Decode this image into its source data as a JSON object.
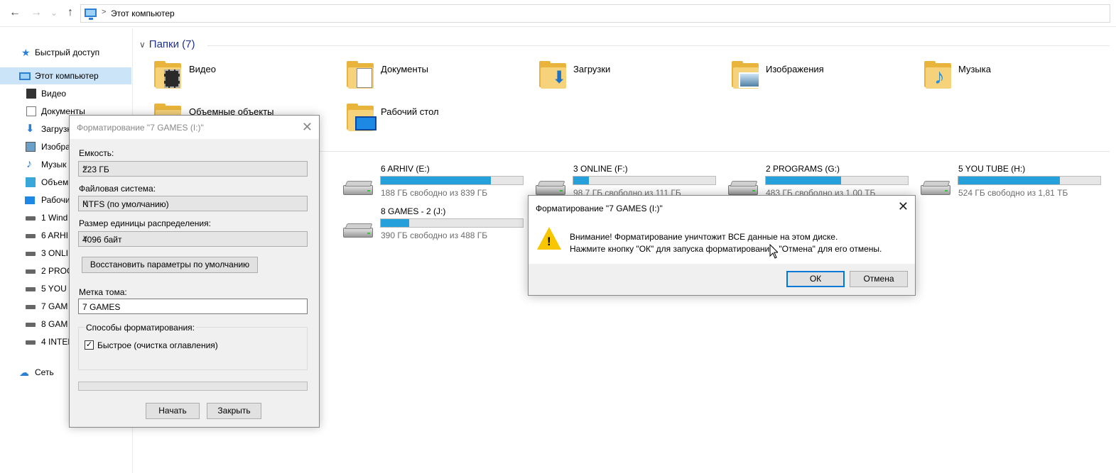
{
  "toolbar": {
    "back": "←",
    "forward": "→",
    "down": "⌄",
    "up": "↑",
    "breadcrumb_sep": ">",
    "breadcrumb": "Этот компьютер"
  },
  "sidebar": {
    "items": [
      {
        "label": "Быстрый доступ",
        "icon": "star-icon"
      },
      {
        "label": "Этот компьютер",
        "icon": "computer-icon"
      },
      {
        "label": "Видео",
        "icon": "video-folder-icon"
      },
      {
        "label": "Документы",
        "icon": "documents-folder-icon"
      },
      {
        "label": "Загрузк",
        "icon": "downloads-folder-icon"
      },
      {
        "label": "Изобра",
        "icon": "pictures-folder-icon"
      },
      {
        "label": "Музык",
        "icon": "music-folder-icon"
      },
      {
        "label": "Объем",
        "icon": "3d-objects-icon"
      },
      {
        "label": "Рабочи",
        "icon": "desktop-icon"
      },
      {
        "label": "1 Wind",
        "icon": "windows-drive-icon"
      },
      {
        "label": "6 ARHI",
        "icon": "drive-icon"
      },
      {
        "label": "3 ONLI",
        "icon": "drive-icon"
      },
      {
        "label": "2 PROG",
        "icon": "drive-icon"
      },
      {
        "label": "5 YOU T",
        "icon": "drive-icon"
      },
      {
        "label": "7 GAM",
        "icon": "drive-icon"
      },
      {
        "label": "8 GAM",
        "icon": "drive-icon"
      },
      {
        "label": "4 INTER",
        "icon": "drive-icon"
      },
      {
        "label": "Сеть",
        "icon": "network-icon"
      }
    ]
  },
  "folders": {
    "header": "Папки (7)",
    "items": [
      {
        "label": "Видео",
        "icon": "video-folder-icon"
      },
      {
        "label": "Документы",
        "icon": "documents-folder-icon"
      },
      {
        "label": "Загрузки",
        "icon": "downloads-folder-icon"
      },
      {
        "label": "Изображения",
        "icon": "pictures-folder-icon"
      },
      {
        "label": "Музыка",
        "icon": "music-folder-icon"
      },
      {
        "label": "Объемные объекты",
        "icon": "3d-objects-folder-icon"
      },
      {
        "label": "Рабочий стол",
        "icon": "desktop-folder-icon"
      }
    ]
  },
  "drives": [
    {
      "name": "6 ARHIV (E:)",
      "free": "188 ГБ свободно из 839 ГБ",
      "used_fraction": 0.776
    },
    {
      "name": "3 ONLINE (F:)",
      "free": "98,7 ГБ свободно из 111 ГБ",
      "used_fraction": 0.111
    },
    {
      "name": "2 PROGRAMS (G:)",
      "free": "483 ГБ свободно из 1,00 ТБ",
      "used_fraction": 0.528
    },
    {
      "name": "5 YOU TUBE (H:)",
      "free": "524 ГБ свободно из 1,81 ТБ",
      "used_fraction": 0.717
    },
    {
      "name": "8 GAMES - 2 (J:)",
      "free": "390 ГБ свободно из 488 ГБ",
      "used_fraction": 0.201
    }
  ],
  "format_dialog": {
    "title": "Форматирование \"7 GAMES (I:)\"",
    "close": "✕",
    "capacity_label": "Емкость:",
    "capacity_value": "223 ГБ",
    "fs_label": "Файловая система:",
    "fs_value": "NTFS (по умолчанию)",
    "alloc_label": "Размер единицы распределения:",
    "alloc_value": "4096 байт",
    "restore_button": "Восстановить параметры по умолчанию",
    "volume_label": "Метка тома:",
    "volume_value": "7 GAMES",
    "options_label": "Способы форматирования:",
    "quick_label": "Быстрое (очистка оглавления)",
    "quick_checked": "✓",
    "progress": 0,
    "start_button": "Начать",
    "close_button": "Закрыть"
  },
  "confirm_dialog": {
    "title": "Форматирование \"7 GAMES (I:)\"",
    "close": "✕",
    "warning_mark": "!",
    "line1": "Внимание! Форматирование уничтожит ВСЕ данные на этом диске.",
    "line2": "Нажмите кнопку \"ОК\" для запуска форматирования, \"Отмена\" для его отмены.",
    "ok_button": "ОК",
    "cancel_button": "Отмена"
  },
  "colors": {
    "accent": "#0078d7",
    "drive_bar": "#26a0da",
    "folder": "#e8b43b",
    "warning": "#f7c600",
    "selection": "#cce4f7"
  }
}
